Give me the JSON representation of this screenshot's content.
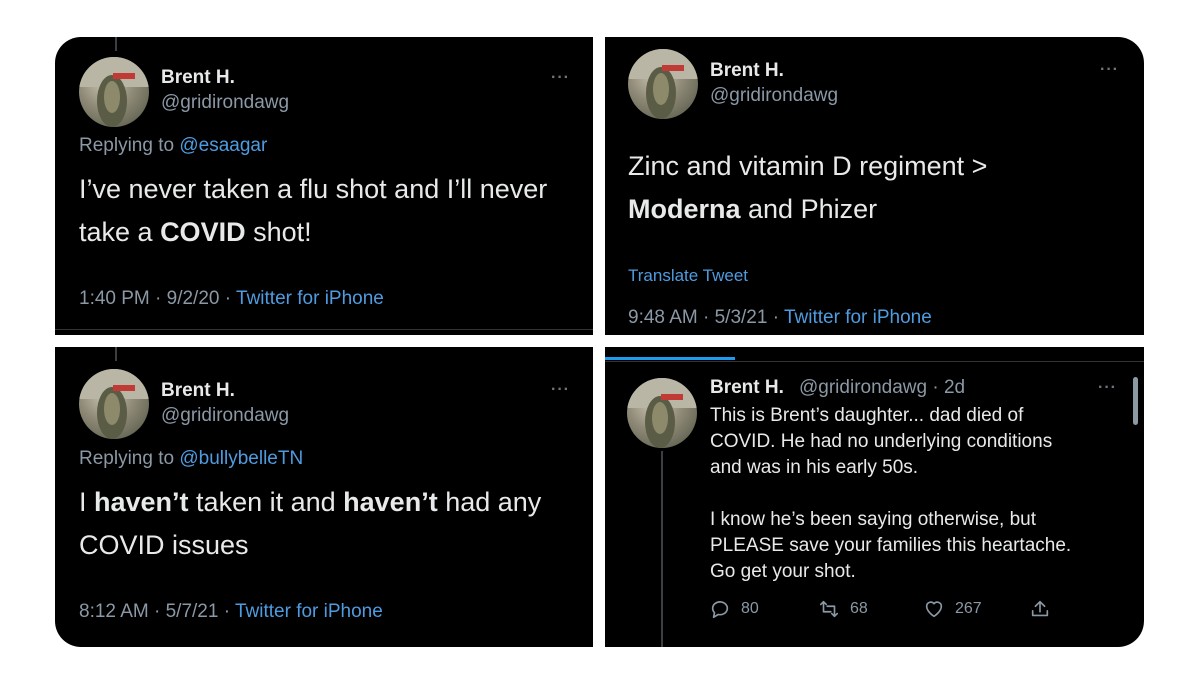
{
  "tweets": [
    {
      "name": "Brent H.",
      "handle": "@gridirondawg",
      "more": "···",
      "replying_prefix": "Replying to ",
      "replying_to": "@esaagar",
      "text_parts": [
        "I’ve never taken a flu shot and I’ll never take a ",
        "COVID",
        " shot!"
      ],
      "time_date": "1:40 PM · 9/2/20 · ",
      "source": "Twitter for iPhone"
    },
    {
      "name": "Brent H.",
      "handle": "@gridirondawg",
      "more": "···",
      "text_line1": "Zinc  and vitamin D regiment >",
      "text_bold": "Moderna",
      "text_rest": " and Phizer",
      "translate": "Translate Tweet",
      "time_date": "9:48 AM · 5/3/21 · ",
      "source": "Twitter for iPhone"
    },
    {
      "name": "Brent H.",
      "handle": "@gridirondawg",
      "more": "···",
      "replying_prefix": "Replying to ",
      "replying_to": "@bullybelleTN",
      "text_parts": [
        "I ",
        "haven’t",
        " taken it and ",
        "haven’t",
        " had any"
      ],
      "text_line2": "COVID issues",
      "time_date": "8:12 AM · 5/7/21 · ",
      "source": "Twitter for iPhone"
    },
    {
      "name": "Brent H.",
      "handle_time": "@gridirondawg · 2d",
      "more": "···",
      "lines": [
        "This is Brent’s daughter... dad died of",
        "COVID. He had no underlying conditions",
        "and was in his early 50s.",
        "",
        "I know he’s been saying otherwise, but",
        "PLEASE save your families this heartache.",
        "Go get your shot."
      ],
      "replies": "80",
      "retweets": "68",
      "likes": "267"
    }
  ],
  "colors": {
    "link": "#4f9be0",
    "muted": "#8b98a5",
    "text": "#e7e9ea",
    "bg": "#000000"
  }
}
